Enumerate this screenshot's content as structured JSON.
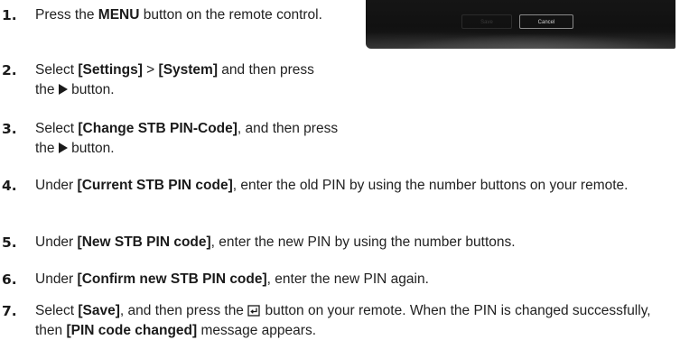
{
  "tv_screenshot": {
    "save_label": "Save",
    "cancel_label": "Cancel"
  },
  "steps": [
    {
      "number": "1.",
      "parts": [
        {
          "t": "Press the "
        },
        {
          "b": "MENU"
        },
        {
          "t": " button on the remote control."
        }
      ]
    },
    {
      "number": "2.",
      "parts": [
        {
          "t": "Select "
        },
        {
          "b": "[Settings]"
        },
        {
          "t": " > "
        },
        {
          "b": "[System]"
        },
        {
          "t": " and then press the "
        },
        {
          "icon": "play-arrow-icon"
        },
        {
          "t": " button."
        }
      ]
    },
    {
      "number": "3.",
      "parts": [
        {
          "t": "Select "
        },
        {
          "b": "[Change STB PIN-Code]"
        },
        {
          "t": ", and then press the "
        },
        {
          "icon": "play-arrow-icon"
        },
        {
          "t": " button."
        }
      ]
    },
    {
      "number": "4.",
      "parts": [
        {
          "t": "Under "
        },
        {
          "b": "[Current STB PIN code]"
        },
        {
          "t": ", enter the old PIN by using the number buttons on your remote."
        }
      ]
    },
    {
      "number": "5.",
      "parts": [
        {
          "t": "Under "
        },
        {
          "b": "[New STB PIN code]"
        },
        {
          "t": ", enter the new PIN by using the number buttons."
        }
      ]
    },
    {
      "number": "6.",
      "parts": [
        {
          "t": "Under "
        },
        {
          "b": "[Confirm new STB PIN code]"
        },
        {
          "t": ", enter the new PIN again."
        }
      ]
    },
    {
      "number": "7.",
      "parts": [
        {
          "t": "Select "
        },
        {
          "b": "[Save]"
        },
        {
          "t": ", and then press the "
        },
        {
          "icon": "enter-icon"
        },
        {
          "t": " button on your remote. When the PIN is changed successfully, then "
        },
        {
          "b": "[PIN code changed]"
        },
        {
          "t": " message appears."
        }
      ]
    }
  ]
}
